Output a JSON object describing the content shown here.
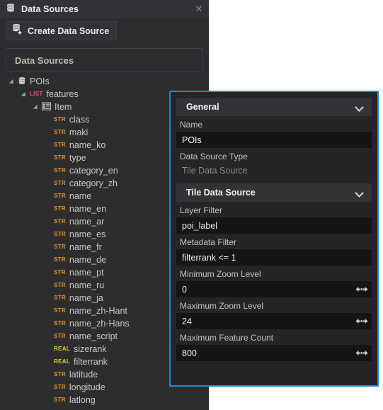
{
  "window": {
    "title": "Data Sources",
    "icon": "database-icon",
    "close_label": "✕"
  },
  "toolbar": {
    "create_label": "Create Data Source",
    "create_icon": "database-plus-icon"
  },
  "list_panel": {
    "header": "Data Sources"
  },
  "tree": {
    "nodes": [
      {
        "label": "POIs",
        "indent": 0,
        "icon": "database-icon",
        "badge": "",
        "badge_type": "",
        "expanded": true
      },
      {
        "label": "features",
        "indent": 1,
        "icon": "",
        "badge": "LIST",
        "badge_type": "list",
        "expanded": true
      },
      {
        "label": "Item",
        "indent": 2,
        "icon": "table-icon",
        "badge": "",
        "badge_type": "",
        "expanded": true
      },
      {
        "label": "class",
        "indent": 3,
        "icon": "",
        "badge": "STR",
        "badge_type": "str"
      },
      {
        "label": "maki",
        "indent": 3,
        "icon": "",
        "badge": "STR",
        "badge_type": "str"
      },
      {
        "label": "name_ko",
        "indent": 3,
        "icon": "",
        "badge": "STR",
        "badge_type": "str"
      },
      {
        "label": "type",
        "indent": 3,
        "icon": "",
        "badge": "STR",
        "badge_type": "str"
      },
      {
        "label": "category_en",
        "indent": 3,
        "icon": "",
        "badge": "STR",
        "badge_type": "str"
      },
      {
        "label": "category_zh",
        "indent": 3,
        "icon": "",
        "badge": "STR",
        "badge_type": "str"
      },
      {
        "label": "name",
        "indent": 3,
        "icon": "",
        "badge": "STR",
        "badge_type": "str"
      },
      {
        "label": "name_en",
        "indent": 3,
        "icon": "",
        "badge": "STR",
        "badge_type": "str"
      },
      {
        "label": "name_ar",
        "indent": 3,
        "icon": "",
        "badge": "STR",
        "badge_type": "str"
      },
      {
        "label": "name_es",
        "indent": 3,
        "icon": "",
        "badge": "STR",
        "badge_type": "str"
      },
      {
        "label": "name_fr",
        "indent": 3,
        "icon": "",
        "badge": "STR",
        "badge_type": "str"
      },
      {
        "label": "name_de",
        "indent": 3,
        "icon": "",
        "badge": "STR",
        "badge_type": "str"
      },
      {
        "label": "name_pt",
        "indent": 3,
        "icon": "",
        "badge": "STR",
        "badge_type": "str"
      },
      {
        "label": "name_ru",
        "indent": 3,
        "icon": "",
        "badge": "STR",
        "badge_type": "str"
      },
      {
        "label": "name_ja",
        "indent": 3,
        "icon": "",
        "badge": "STR",
        "badge_type": "str"
      },
      {
        "label": "name_zh-Hant",
        "indent": 3,
        "icon": "",
        "badge": "STR",
        "badge_type": "str"
      },
      {
        "label": "name_zh-Hans",
        "indent": 3,
        "icon": "",
        "badge": "STR",
        "badge_type": "str"
      },
      {
        "label": "name_script",
        "indent": 3,
        "icon": "",
        "badge": "STR",
        "badge_type": "str"
      },
      {
        "label": "sizerank",
        "indent": 3,
        "icon": "",
        "badge": "REAL",
        "badge_type": "real"
      },
      {
        "label": "filterrank",
        "indent": 3,
        "icon": "",
        "badge": "REAL",
        "badge_type": "real"
      },
      {
        "label": "latitude",
        "indent": 3,
        "icon": "",
        "badge": "STR",
        "badge_type": "str"
      },
      {
        "label": "longitude",
        "indent": 3,
        "icon": "",
        "badge": "STR",
        "badge_type": "str"
      },
      {
        "label": "latlong",
        "indent": 3,
        "icon": "",
        "badge": "STR",
        "badge_type": "str"
      }
    ]
  },
  "properties": {
    "general": {
      "title": "General",
      "name_label": "Name",
      "name_value": "POIs",
      "type_label": "Data Source Type",
      "type_value": "Tile Data Source"
    },
    "tile": {
      "title": "Tile Data Source",
      "layer_filter_label": "Layer Filter",
      "layer_filter_value": "poi_label",
      "metadata_filter_label": "Metadata Filter",
      "metadata_filter_value": "filterrank <= 1",
      "min_zoom_label": "Minimum Zoom Level",
      "min_zoom_value": "0",
      "max_zoom_label": "Maximum Zoom Level",
      "max_zoom_value": "24",
      "max_feature_label": "Maximum Feature Count",
      "max_feature_value": "800"
    }
  },
  "colors": {
    "accent_border": "#1f8ad2",
    "panel_bg": "#252526",
    "dock_bg": "#2d2d30",
    "header_bg": "#333337",
    "input_bg": "#151516",
    "badge_list": "#e0559e",
    "badge_str": "#e8932b",
    "badge_real": "#d8cf32"
  }
}
